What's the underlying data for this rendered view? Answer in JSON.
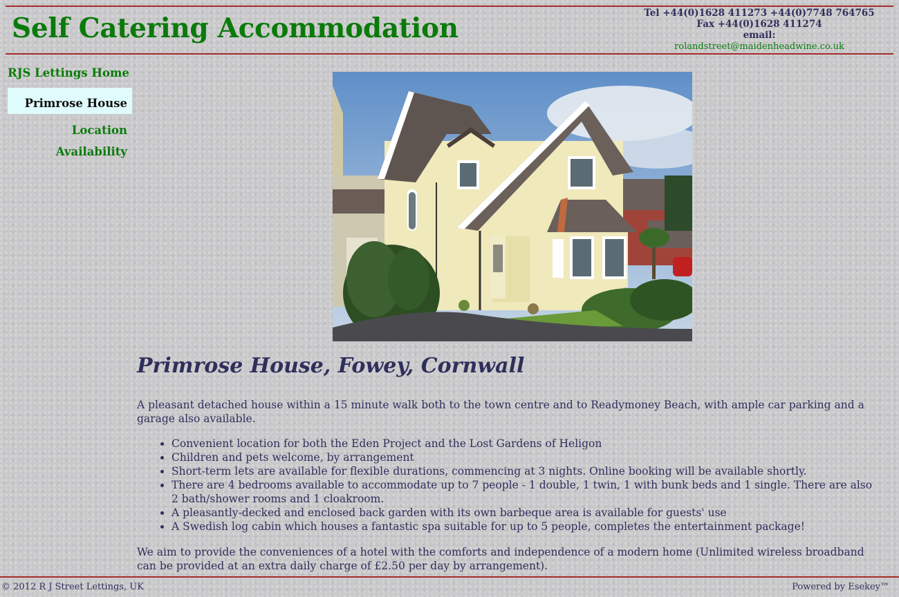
{
  "header": {
    "title": "Self Catering Accommodation",
    "tel": "Tel +44(0)1628 411273 +44(0)7748 764765",
    "fax": "Fax +44(0)1628 411274",
    "email_label": "email:",
    "email": "rolandstreet@maidenheadwine.co.uk"
  },
  "nav": {
    "items": [
      {
        "label": "RJS Lettings Home"
      },
      {
        "label": "Primrose House"
      },
      {
        "label": "Location"
      },
      {
        "label": "Availability"
      }
    ]
  },
  "main": {
    "title": "Primrose House, Fowey, Cornwall",
    "intro": "A pleasant detached house within a 15 minute walk both to the town centre and to Readymoney Beach, with ample car parking and a garage also available.",
    "features": [
      "Convenient location for both the Eden Project and the Lost Gardens of Heligon",
      "Children and pets welcome, by arrangement",
      "Short-term lets are available for flexible durations, commencing at 3 nights. Online booking will be available shortly.",
      "There are 4 bedrooms available to accommodate up to 7 people - 1 double, 1 twin, 1 with bunk beds and 1 single. There are also 2 bath/shower rooms and 1 cloakroom.",
      "A pleasantly-decked and enclosed back garden with its own barbeque area is available for guests' use",
      "A Swedish log cabin which houses a fantastic spa suitable for up to 5 people, completes the entertainment package!"
    ],
    "outro": "We aim to provide the conveniences of a hotel with the comforts and independence of a modern home (Unlimited wireless broadband can be provided at an extra daily charge of £2.50 per day by arrangement)."
  },
  "footer": {
    "copyright": "© 2012 R J Street Lettings, UK",
    "powered": "Powered by Esekey™"
  },
  "colors": {
    "title_green": "#0a7a0a",
    "rule_red": "#a52a2a",
    "text_navy": "#2f2f5c",
    "active_nav_bg": "#e0fbfb"
  }
}
